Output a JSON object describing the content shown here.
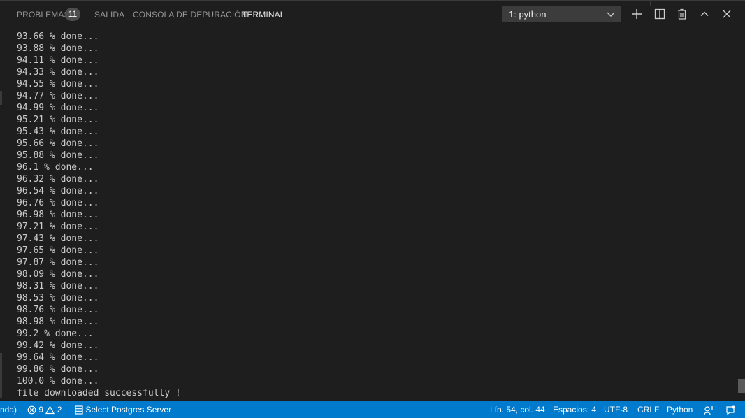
{
  "tabs": {
    "problems": "PROBLEMAS",
    "problems_count": "11",
    "output": "SALIDA",
    "debug_console": "CONSOLA DE DEPURACIÓN",
    "terminal": "TERMINAL"
  },
  "terminal_select": {
    "value": "1: python",
    "icon": "chevron-down-icon"
  },
  "toolbar_icons": [
    "plus-icon",
    "split-icon",
    "trash-icon",
    "chevron-up-icon",
    "close-icon"
  ],
  "terminal_lines": [
    "93.66 % done...",
    "93.88 % done...",
    "94.11 % done...",
    "94.33 % done...",
    "94.55 % done...",
    "94.77 % done...",
    "94.99 % done...",
    "95.21 % done...",
    "95.43 % done...",
    "95.66 % done...",
    "95.88 % done...",
    "96.1 % done...",
    "96.32 % done...",
    "96.54 % done...",
    "96.76 % done...",
    "96.98 % done...",
    "97.21 % done...",
    "97.43 % done...",
    "97.65 % done...",
    "97.87 % done...",
    "98.09 % done...",
    "98.31 % done...",
    "98.53 % done...",
    "98.76 % done...",
    "98.98 % done...",
    "99.2 % done...",
    "99.42 % done...",
    "99.64 % done...",
    "99.86 % done...",
    "100.0 % done...",
    "file downloaded successfully !"
  ],
  "statusbar": {
    "env": "nda)",
    "errors": "9",
    "warnings": "2",
    "postgres": "Select Postgres Server",
    "position": "Lín. 54, col. 44",
    "spaces": "Espacios: 4",
    "encoding": "UTF-8",
    "eol": "CRLF",
    "language": "Python"
  },
  "colors": {
    "background": "#1e1e1e",
    "statusbar": "#007acc",
    "text": "#cccccc"
  }
}
